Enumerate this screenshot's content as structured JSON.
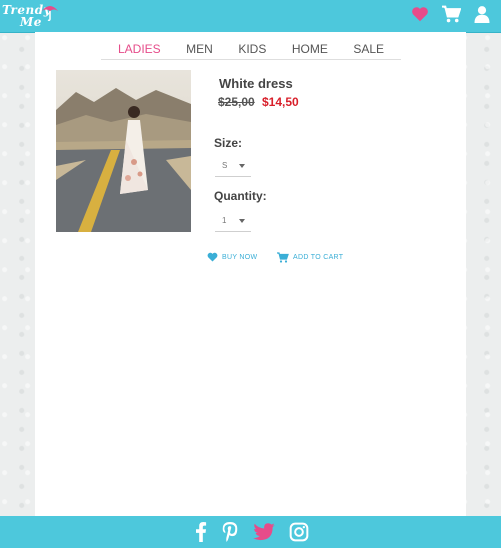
{
  "brand": {
    "line1": "Trendy",
    "line2": "Me"
  },
  "colors": {
    "header": "#4dc8dc",
    "accent_pink": "#e64c8a",
    "sale_red": "#d81f2a",
    "link_blue": "#3aaed6"
  },
  "header": {
    "icons": [
      "heart-icon",
      "cart-icon",
      "user-icon"
    ]
  },
  "nav": {
    "items": [
      "LADIES",
      "MEN",
      "KIDS",
      "HOME",
      "SALE"
    ],
    "active": "LADIES"
  },
  "product": {
    "title": "White dress",
    "old_price": "$25,00",
    "new_price": "$14,50",
    "size_label": "Size:",
    "size_value": "S",
    "quantity_label": "Quantity:",
    "quantity_value": "1",
    "buy_now": "BUY NOW",
    "add_to_cart": "ADD TO CART"
  },
  "footer": {
    "icons": [
      "facebook-icon",
      "pinterest-icon",
      "twitter-icon",
      "instagram-icon"
    ]
  }
}
